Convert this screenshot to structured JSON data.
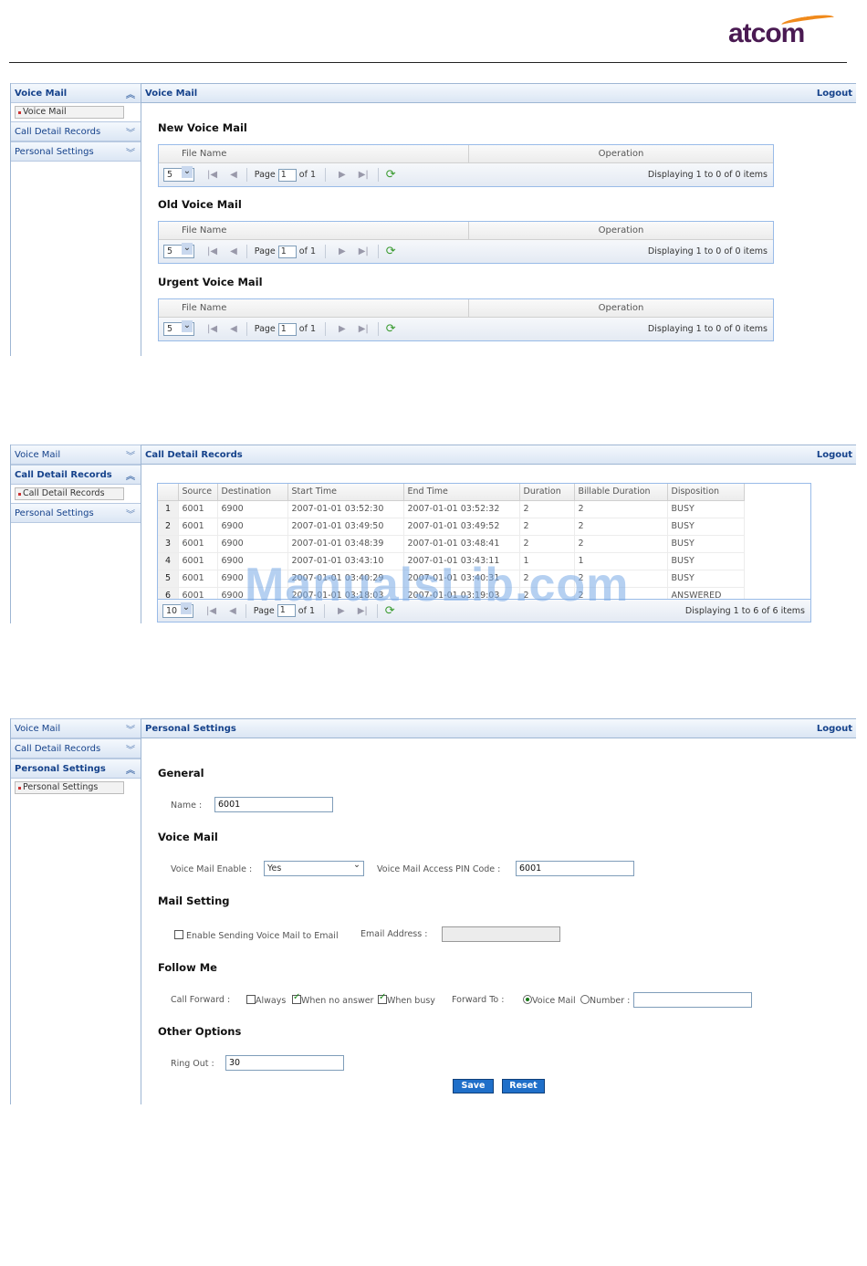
{
  "brand": {
    "logo_text": "atcom",
    "swoosh_color": "#f08a1c",
    "text_color": "#4a1a52"
  },
  "nav": {
    "voice_mail": "Voice Mail",
    "cdr": "Call Detail Records",
    "personal_settings": "Personal Settings",
    "logout": "Logout"
  },
  "voicemail_panel": {
    "header": "Voice Mail",
    "sub_item": "Voice Mail",
    "sections": [
      {
        "title": "New Voice Mail"
      },
      {
        "title": "Old Voice Mail"
      },
      {
        "title": "Urgent Voice Mail"
      }
    ],
    "col_file": "File Name",
    "col_op": "Operation",
    "page_size": "5",
    "page_label": "Page",
    "page_value": "1",
    "of_label": "of 1",
    "display": "Displaying 1 to 0 of 0 items"
  },
  "cdr_panel": {
    "header": "Call Detail Records",
    "sub_item": "Call Detail Records",
    "columns": [
      "Source",
      "Destination",
      "Start Time",
      "End Time",
      "Duration",
      "Billable Duration",
      "Disposition"
    ],
    "rows": [
      [
        "1",
        "6001",
        "6900",
        "2007-01-01 03:52:30",
        "2007-01-01 03:52:32",
        "2",
        "2",
        "BUSY"
      ],
      [
        "2",
        "6001",
        "6900",
        "2007-01-01 03:49:50",
        "2007-01-01 03:49:52",
        "2",
        "2",
        "BUSY"
      ],
      [
        "3",
        "6001",
        "6900",
        "2007-01-01 03:48:39",
        "2007-01-01 03:48:41",
        "2",
        "2",
        "BUSY"
      ],
      [
        "4",
        "6001",
        "6900",
        "2007-01-01 03:43:10",
        "2007-01-01 03:43:11",
        "1",
        "1",
        "BUSY"
      ],
      [
        "5",
        "6001",
        "6900",
        "2007-01-01 03:40:29",
        "2007-01-01 03:40:31",
        "2",
        "2",
        "BUSY"
      ],
      [
        "6",
        "6001",
        "6900",
        "2007-01-01 03:18:03",
        "2007-01-01 03:19:03",
        "2",
        "2",
        "ANSWERED"
      ]
    ],
    "page_size": "10",
    "page_label": "Page",
    "page_value": "1",
    "of_label": "of 1",
    "display": "Displaying 1 to 6 of 6 items"
  },
  "watermark": "ManualsLib.com",
  "settings_panel": {
    "header": "Personal Settings",
    "sub_item": "Personal Settings",
    "general": "General",
    "name_label": "Name :",
    "name_value": "6001",
    "voice_mail": "Voice Mail",
    "vm_enable_label": "Voice Mail Enable :",
    "vm_enable_value": "Yes",
    "vm_pin_label": "Voice Mail Access PIN Code :",
    "vm_pin_value": "6001",
    "mail_setting": "Mail Setting",
    "enable_email_label": "Enable Sending Voice Mail to Email",
    "email_label": "Email Address :",
    "email_value": "",
    "follow_me": "Follow Me",
    "call_forward_label": "Call Forward :",
    "always_label": "Always",
    "no_answer_label": "When no answer",
    "busy_label": "When busy",
    "forward_to_label": "Forward To :",
    "voice_mail_option": "Voice Mail",
    "number_option": "Number :",
    "number_value": "",
    "other_options": "Other Options",
    "ring_out_label": "Ring Out :",
    "ring_out_value": "30",
    "save": "Save",
    "reset": "Reset"
  }
}
